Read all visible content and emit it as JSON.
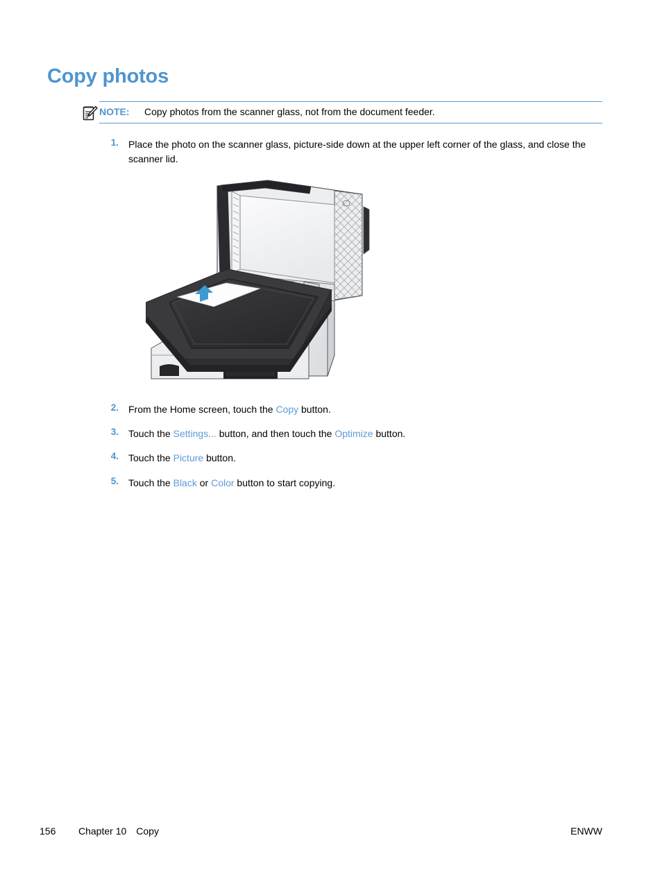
{
  "document": {
    "title": "Copy photos"
  },
  "note": {
    "icon": "note-pencil-icon",
    "label": "NOTE:",
    "text": "Copy photos from the scanner glass, not from the document feeder.",
    "rule_color": "#5b9bd5",
    "label_color": "#4e95d0"
  },
  "steps": [
    {
      "number": "1.",
      "line1": "Place the photo on the scanner glass, picture-side down at the upper left corner of the glass,",
      "line2": "and close the scanner lid."
    },
    {
      "number": "2.",
      "pre": "From the Home screen, touch the ",
      "link1": "Copy",
      "post": " button."
    },
    {
      "number": "3.",
      "pre": "Touch the ",
      "link1": "Settings...",
      "mid": " button, and then touch the ",
      "link2": "Optimize",
      "post": " button."
    },
    {
      "number": "4.",
      "pre": "Touch the ",
      "link1": "Picture",
      "post": " button."
    },
    {
      "number": "5.",
      "pre": "Touch the ",
      "link1": "Black",
      "mid": " or ",
      "link2": "Color",
      "post": " button to start copying."
    }
  ],
  "figure": {
    "name": "scanner-glass-photo-placement-illustration",
    "description": "Printer with scanner lid open showing a photo placed face-down at the upper left corner of the scanner glass, with a blue arrow indicating the corner",
    "arrow_color": "#3d9ad4",
    "glass_color": "#333333",
    "body_color": "#e9eaec"
  },
  "footer": {
    "page_number": "156",
    "chapter": "Chapter 10",
    "section": "Copy",
    "locale": "ENWW"
  },
  "theme": {
    "heading_color": "#4e95d0",
    "link_color": "#5b9bd5",
    "text_color": "#000000",
    "background": "#ffffff"
  }
}
